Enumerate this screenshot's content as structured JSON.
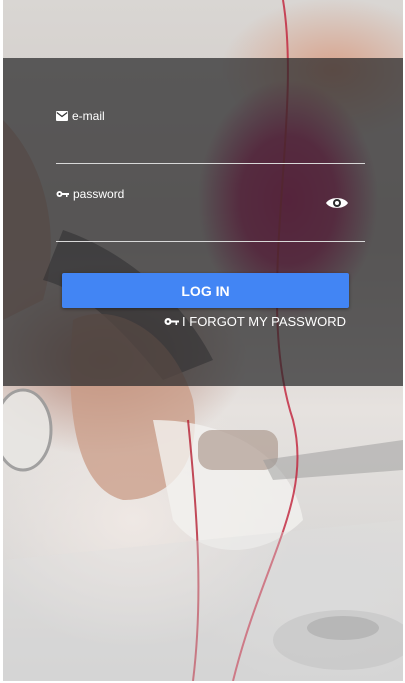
{
  "login": {
    "email_label": "e-mail",
    "email_value": "",
    "password_label": "password",
    "password_value": "",
    "submit_label": "LOG IN",
    "forgot_label": "I FORGOT MY PASSWORD"
  },
  "icons": {
    "email": "envelope-icon",
    "password": "key-icon",
    "show_password": "eye-icon",
    "forgot": "key-icon"
  },
  "colors": {
    "primary_button": "#4285f4",
    "overlay": "rgba(40,40,42,0.72)",
    "text": "#ffffff"
  }
}
